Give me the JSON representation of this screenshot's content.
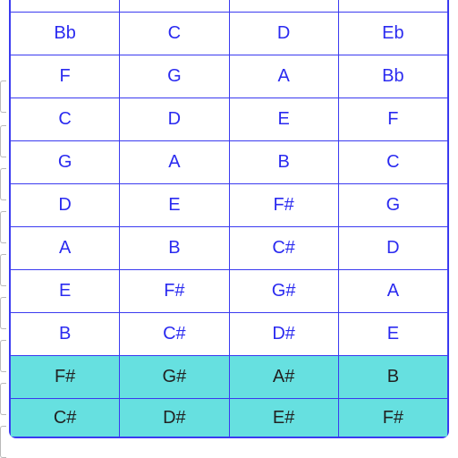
{
  "colors": {
    "border": "#3a3af0",
    "headerText": "#2a2af0",
    "highlightBg": "#66e0e0",
    "bodyText": "#222222"
  },
  "table": {
    "rows": [
      {
        "style": "header",
        "cells": [
          "",
          "",
          "",
          ""
        ]
      },
      {
        "style": "header",
        "cells": [
          "Bb",
          "C",
          "D",
          "Eb"
        ]
      },
      {
        "style": "header",
        "cells": [
          "F",
          "G",
          "A",
          "Bb"
        ]
      },
      {
        "style": "header",
        "cells": [
          "C",
          "D",
          "E",
          "F"
        ]
      },
      {
        "style": "header",
        "cells": [
          "G",
          "A",
          "B",
          "C"
        ]
      },
      {
        "style": "header",
        "cells": [
          "D",
          "E",
          "F#",
          "G"
        ]
      },
      {
        "style": "header",
        "cells": [
          "A",
          "B",
          "C#",
          "D"
        ]
      },
      {
        "style": "header",
        "cells": [
          "E",
          "F#",
          "G#",
          "A"
        ]
      },
      {
        "style": "header",
        "cells": [
          "B",
          "C#",
          "D#",
          "E"
        ]
      },
      {
        "style": "highlight",
        "cells": [
          "F#",
          "G#",
          "A#",
          "B"
        ]
      },
      {
        "style": "highlight",
        "cells": [
          "C#",
          "D#",
          "E#",
          "F#"
        ]
      }
    ]
  }
}
